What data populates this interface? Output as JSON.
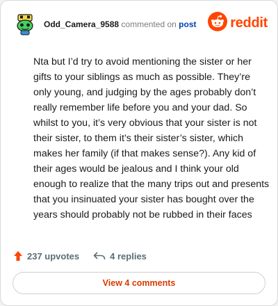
{
  "header": {
    "username": "Odd_Camera_9588",
    "commented_text": "commented on",
    "post_link": "post",
    "brand": "reddit",
    "avatar_icon": "snoo-avatar-icon",
    "brand_icon": "reddit-logo-icon"
  },
  "comment": {
    "body": "Nta but I’d try to avoid mentioning the sister or her gifts to your siblings as much as possible. They’re only young, and judging by the ages probably don’t really remember life before you and your dad. So whilst to you, it’s very obvious that your sister is not their sister, to them it’s their sister’s sister, which makes her family (if that makes sense?). Any kid of their ages would be jealous and I think your old enough to realize that the many trips out and presents that you insinuated your sister has bought over the years should probably not be rubbed in their faces"
  },
  "actions": {
    "upvotes": "237 upvotes",
    "replies": "4 replies",
    "upvote_icon": "upvote-arrow-icon",
    "reply_icon": "reply-arrow-icon"
  },
  "view_button": {
    "label": "View 4 comments"
  },
  "colors": {
    "brand_orange": "#ff4500",
    "upvote_orange": "#ff4500",
    "link_blue": "#0045ac",
    "button_text": "#d93a00"
  }
}
